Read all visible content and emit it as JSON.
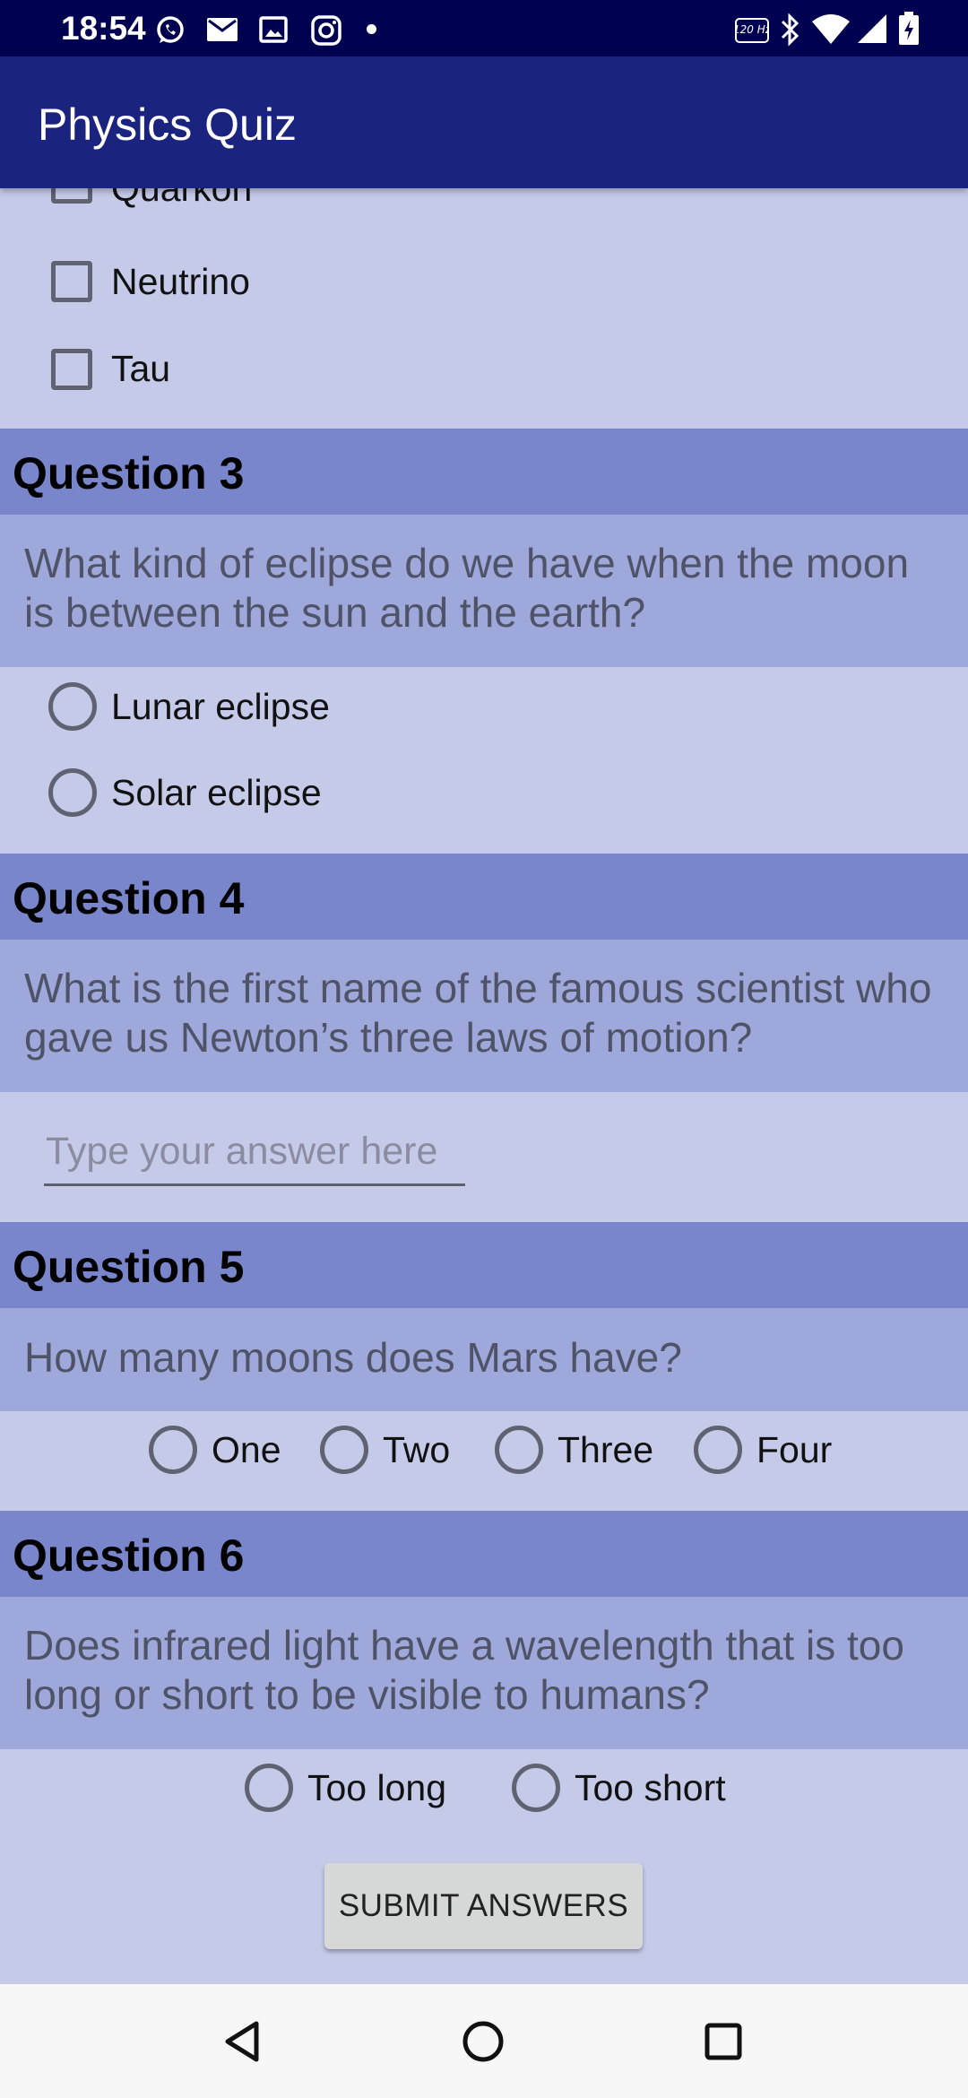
{
  "status_bar": {
    "time": "18:54",
    "left_icons": [
      "whatsapp-icon",
      "mail-icon",
      "image-icon",
      "instagram-icon",
      "dot-icon"
    ],
    "right_icons": [
      "refresh-rate-icon",
      "bluetooth-icon",
      "wifi-icon",
      "signal-icon",
      "battery-icon"
    ],
    "refresh_rate": "120 Hz"
  },
  "app_bar": {
    "title": "Physics Quiz"
  },
  "question2": {
    "options": [
      {
        "label": "Quarkon",
        "checked": false
      },
      {
        "label": "Neutrino",
        "checked": false
      },
      {
        "label": "Tau",
        "checked": false
      }
    ]
  },
  "question3": {
    "header": "Question 3",
    "text": "What kind of eclipse do we have when the moon is between the sun and the earth?",
    "options": [
      {
        "label": "Lunar eclipse",
        "selected": false
      },
      {
        "label": "Solar eclipse",
        "selected": false
      }
    ]
  },
  "question4": {
    "header": "Question 4",
    "text": "What is the first name of the famous scientist who gave us Newton’s three laws of motion?",
    "input_value": "",
    "input_placeholder": "Type your answer here"
  },
  "question5": {
    "header": "Question 5",
    "text": "How many moons does Mars have?",
    "options": [
      {
        "label": "One",
        "selected": false
      },
      {
        "label": "Two",
        "selected": false
      },
      {
        "label": "Three",
        "selected": false
      },
      {
        "label": "Four",
        "selected": false
      }
    ]
  },
  "question6": {
    "header": "Question 6",
    "text": "Does infrared light have a wavelength that is too long or short to be visible to humans?",
    "options": [
      {
        "label": "Too long",
        "selected": false
      },
      {
        "label": "Too short",
        "selected": false
      }
    ]
  },
  "submit": {
    "label": "SUBMIT ANSWERS"
  },
  "nav_bar": {
    "buttons": [
      "back-icon",
      "home-icon",
      "recents-icon"
    ]
  },
  "colors": {
    "status_bar": "#000051",
    "app_bar": "#1a237e",
    "background": "#c5cae9",
    "question_header": "#7986cb",
    "question_text_bg": "#9fa8da"
  }
}
